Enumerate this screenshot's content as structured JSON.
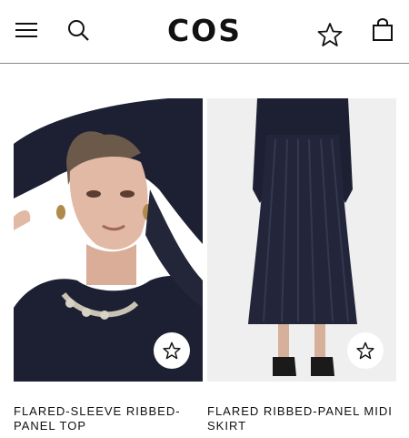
{
  "header": {
    "logo": "COS",
    "icons": {
      "menu": "hamburger-menu-icon",
      "search": "search-icon",
      "favorites": "star-icon",
      "bag": "shopping-bag-icon"
    }
  },
  "products": [
    {
      "name": "FLARED-SLEEVE RIBBED-PANEL TOP",
      "image": "model-in-navy-ribbed-top",
      "favorite_icon": "star-icon"
    },
    {
      "name": "FLARED RIBBED-PANEL MIDI SKIRT",
      "image": "model-in-navy-ribbed-midi-skirt",
      "favorite_icon": "star-icon"
    }
  ],
  "colors": {
    "garment": "#1d2032",
    "background": "#ffffff",
    "photo_bg": "#efefef",
    "divider": "#8a8a8a"
  }
}
